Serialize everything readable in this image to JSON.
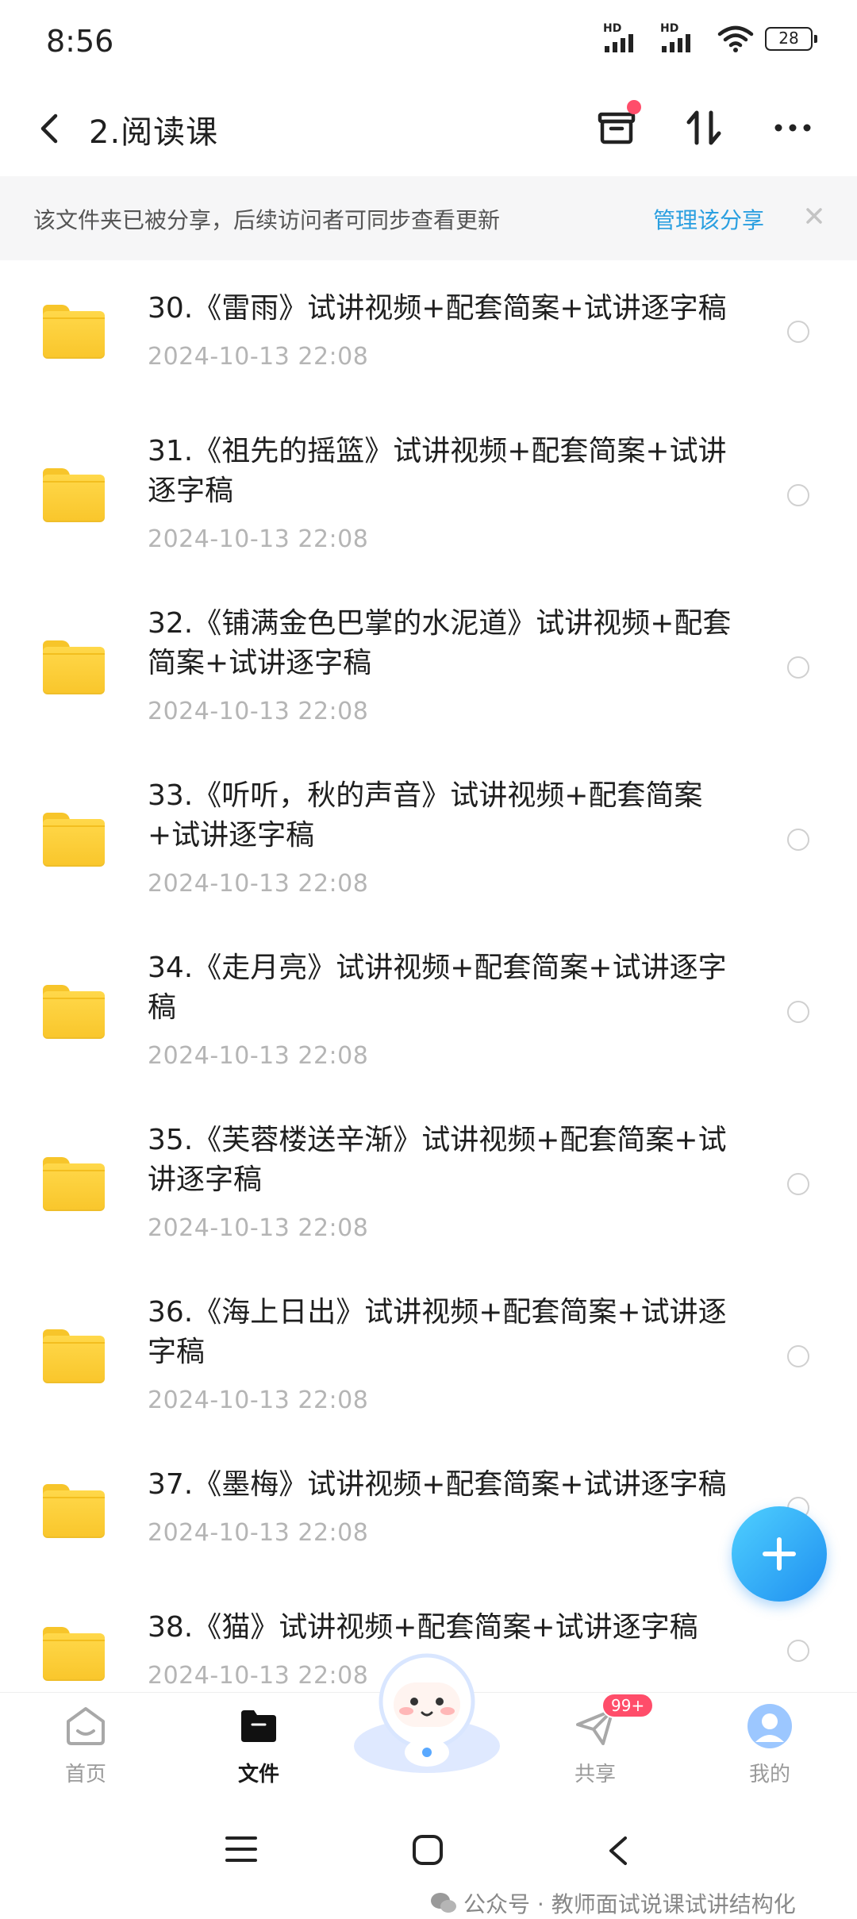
{
  "status_bar": {
    "time": "8:56",
    "battery": "28",
    "signal_label": "HD"
  },
  "header": {
    "title": "2.阅读课"
  },
  "banner": {
    "text": "该文件夹已被分享，后续访问者可同步查看更新",
    "link": "管理该分享"
  },
  "items": [
    {
      "name": "30.《雷雨》试讲视频+配套简案+试讲逐字稿",
      "date": "2024-10-13  22:08"
    },
    {
      "name": "31.《祖先的摇篮》试讲视频+配套简案+试讲逐字稿",
      "date": "2024-10-13  22:08"
    },
    {
      "name": "32.《铺满金色巴掌的水泥道》试讲视频+配套简案+试讲逐字稿",
      "date": "2024-10-13  22:08"
    },
    {
      "name": "33.《听听，秋的声音》试讲视频+配套简案+试讲逐字稿",
      "date": "2024-10-13  22:08"
    },
    {
      "name": "34.《走月亮》试讲视频+配套简案+试讲逐字稿",
      "date": "2024-10-13  22:08"
    },
    {
      "name": "35.《芙蓉楼送辛渐》试讲视频+配套简案+试讲逐字稿",
      "date": "2024-10-13  22:08"
    },
    {
      "name": "36.《海上日出》试讲视频+配套简案+试讲逐字稿",
      "date": "2024-10-13  22:08"
    },
    {
      "name": "37.《墨梅》试讲视频+配套简案+试讲逐字稿",
      "date": "2024-10-13  22:08"
    },
    {
      "name": "38.《猫》试讲视频+配套简案+试讲逐字稿",
      "date": "2024-10-13  22:08"
    }
  ],
  "bottom_nav": [
    {
      "label": "首页",
      "icon": "home-icon"
    },
    {
      "label": "文件",
      "icon": "folder-icon"
    },
    {
      "label": "共享",
      "icon": "send-icon",
      "badge": "99+"
    },
    {
      "label": "我的",
      "icon": "profile-icon"
    }
  ],
  "watermark": "公众号 · 教师面试说课试讲结构化",
  "colors": {
    "accent": "#2a9fe0",
    "folder": "#ffd84a",
    "badge": "#ff4d6a",
    "fab": "#1f8ff0"
  }
}
